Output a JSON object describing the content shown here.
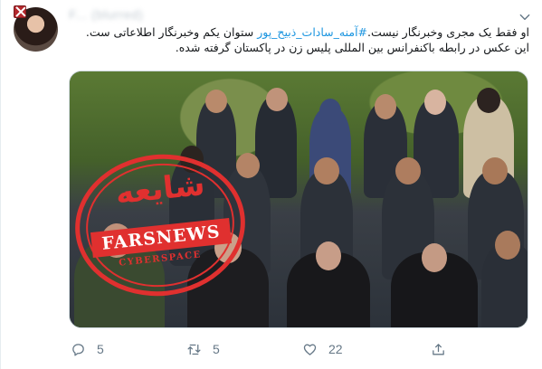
{
  "author": {
    "avatar_icon": "profile-avatar",
    "name": "F... (blurred)"
  },
  "tweet": {
    "line1_plain": "او فقط یک مجری وخبرنگار نیست.",
    "line1_hashtag": "#آمنه_سادات_ذبیح_پور",
    "line1_tail": " ستوان یکم وخبرنگار اطلاعاتی ست.",
    "line2": "این عکس در رابطه باکنفرانس بین المللی پلیس زن در پاکستان گرفته شده."
  },
  "stamp": {
    "label_fa": "شایعه",
    "brand": "FARSNEWS",
    "sub": "CYBERSPACE",
    "color": "#e0302f"
  },
  "actions": {
    "reply": {
      "icon": "reply-icon",
      "count": "5"
    },
    "retweet": {
      "icon": "retweet-icon",
      "count": "5"
    },
    "like": {
      "icon": "heart-icon",
      "count": "22"
    },
    "share": {
      "icon": "share-icon"
    }
  },
  "colors": {
    "hashtag": "#1b95e0",
    "muted": "#657786"
  }
}
